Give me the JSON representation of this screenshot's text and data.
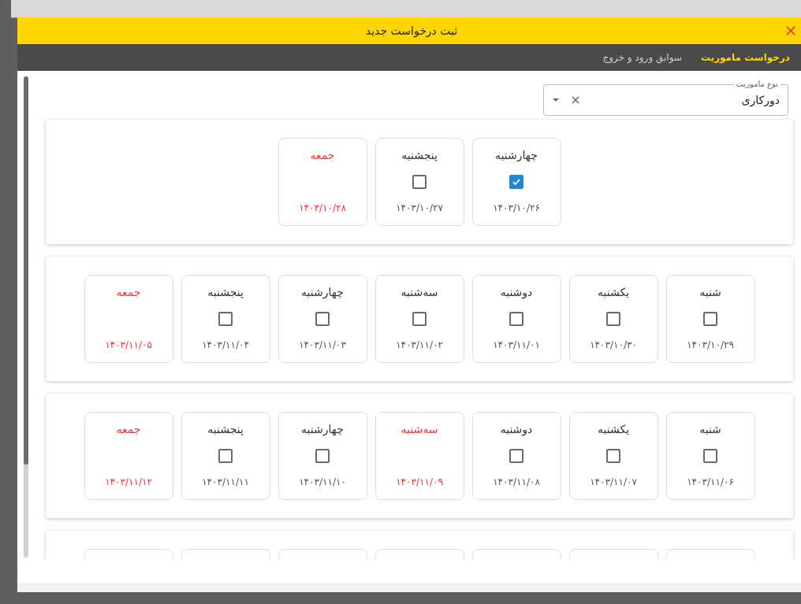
{
  "dialog": {
    "title": "ثبت درخواست جدید"
  },
  "tabs": [
    {
      "label": "درخواست ماموریت",
      "selected": true
    },
    {
      "label": "سوابق ورود و خروج",
      "selected": false
    }
  ],
  "mission_type": {
    "label": "نوع ماموریت",
    "value": "دورکاری"
  },
  "weeks": [
    {
      "days": [
        {
          "day": "چهارشنبه",
          "date": "۱۴۰۳/۱۰/۲۶",
          "kind": "workday",
          "checked": true
        },
        {
          "day": "پنجشنبه",
          "date": "۱۴۰۳/۱۰/۲۷",
          "kind": "workday",
          "checked": false
        },
        {
          "day": "جمعه",
          "date": "۱۴۰۳/۱۰/۲۸",
          "kind": "holiday"
        }
      ]
    },
    {
      "days": [
        {
          "day": "شنبه",
          "date": "۱۴۰۳/۱۰/۲۹",
          "kind": "workday",
          "checked": false
        },
        {
          "day": "یکشنبه",
          "date": "۱۴۰۳/۱۰/۳۰",
          "kind": "workday",
          "checked": false
        },
        {
          "day": "دوشنبه",
          "date": "۱۴۰۳/۱۱/۰۱",
          "kind": "workday",
          "checked": false
        },
        {
          "day": "سه‌شنبه",
          "date": "۱۴۰۳/۱۱/۰۲",
          "kind": "workday",
          "checked": false
        },
        {
          "day": "چهارشنبه",
          "date": "۱۴۰۳/۱۱/۰۳",
          "kind": "workday",
          "checked": false
        },
        {
          "day": "پنجشنبه",
          "date": "۱۴۰۳/۱۱/۰۴",
          "kind": "workday",
          "checked": false
        },
        {
          "day": "جمعه",
          "date": "۱۴۰۳/۱۱/۰۵",
          "kind": "holiday"
        }
      ]
    },
    {
      "days": [
        {
          "day": "شنبه",
          "date": "۱۴۰۳/۱۱/۰۶",
          "kind": "workday",
          "checked": false
        },
        {
          "day": "یکشنبه",
          "date": "۱۴۰۳/۱۱/۰۷",
          "kind": "workday",
          "checked": false
        },
        {
          "day": "دوشنبه",
          "date": "۱۴۰۳/۱۱/۰۸",
          "kind": "workday",
          "checked": false
        },
        {
          "day": "سه‌شنبه",
          "date": "۱۴۰۳/۱۱/۰۹",
          "kind": "holiday"
        },
        {
          "day": "چهارشنبه",
          "date": "۱۴۰۳/۱۱/۱۰",
          "kind": "workday",
          "checked": false
        },
        {
          "day": "پنجشنبه",
          "date": "۱۴۰۳/۱۱/۱۱",
          "kind": "workday",
          "checked": false
        },
        {
          "day": "جمعه",
          "date": "۱۴۰۳/۱۱/۱۲",
          "kind": "holiday"
        }
      ]
    }
  ]
}
